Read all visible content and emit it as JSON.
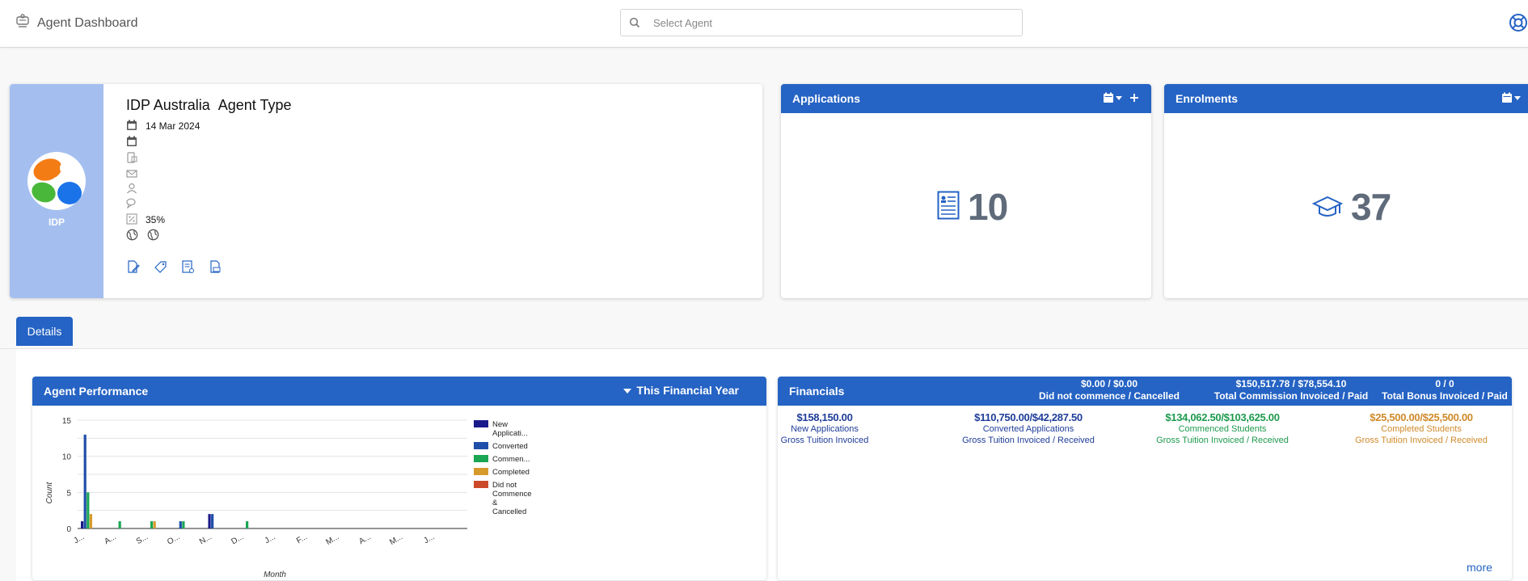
{
  "header": {
    "title": "Agent Dashboard",
    "search_placeholder": "Select Agent"
  },
  "agent": {
    "name": "IDP Australia",
    "type_label": "Agent Type",
    "logo_label": "IDP",
    "date": "14 Mar 2024",
    "commission_rate": "35%"
  },
  "applications": {
    "title": "Applications",
    "count": "10"
  },
  "enrolments": {
    "title": "Enrolments",
    "count": "37"
  },
  "tabs": {
    "details": "Details"
  },
  "performance": {
    "title": "Agent Performance",
    "period": "This Financial Year"
  },
  "financials": {
    "title": "Financials",
    "summary": [
      {
        "value": "$0.00 / $0.00",
        "label": "Did not commence / Cancelled"
      },
      {
        "value": "$150,517.78 / $78,554.10",
        "label": "Total Commission Invoiced / Paid"
      },
      {
        "value": "0 / 0",
        "label": "Total Bonus Invoiced / Paid"
      }
    ],
    "columns": [
      {
        "value": "$158,150.00",
        "label": "New Applications",
        "sub": "Gross Tuition Invoiced",
        "color": "#1f3d99"
      },
      {
        "value": "$110,750.00/$42,287.50",
        "label": "Converted Applications",
        "sub": "Gross Tuition Invoiced / Received",
        "color": "#1f3d99"
      },
      {
        "value": "$134,062.50/$103,625.00",
        "label": "Commenced Students",
        "sub": "Gross Tuition Invoiced / Received",
        "color": "#1e9a4e"
      },
      {
        "value": "$25,500.00/$25,500.00",
        "label": "Completed Students",
        "sub": "Gross Tuition Invoiced / Received",
        "color": "#d08a2a"
      }
    ],
    "more": "more"
  },
  "colors": {
    "brand_blue": "#2563c4",
    "profile_side": "#a4bfef"
  },
  "chart_data": {
    "type": "bar",
    "xlabel": "Month",
    "ylabel": "Count",
    "ylim": [
      0,
      15
    ],
    "yticks": [
      0,
      5,
      10,
      15
    ],
    "grid": true,
    "legend_position": "right",
    "categories": [
      "J...",
      "A...",
      "S...",
      "O...",
      "N...",
      "D...",
      "J...",
      "F...",
      "M...",
      "A...",
      "M...",
      "J..."
    ],
    "series": [
      {
        "name": "New Applicati...",
        "color": "#1a1a8c",
        "values": [
          1,
          0,
          0,
          0,
          2,
          0,
          0,
          0,
          0,
          0,
          0,
          0
        ]
      },
      {
        "name": "Converted",
        "color": "#1f4fa8",
        "values": [
          13,
          0,
          0,
          1,
          2,
          0,
          0,
          0,
          0,
          0,
          0,
          0
        ]
      },
      {
        "name": "Commen...",
        "color": "#1aa653",
        "values": [
          5,
          1,
          1,
          1,
          0,
          1,
          0,
          0,
          0,
          0,
          0,
          0
        ]
      },
      {
        "name": "Completed",
        "color": "#d69a2c",
        "values": [
          2,
          0,
          1,
          0,
          0,
          0,
          0,
          0,
          0,
          0,
          0,
          0
        ]
      },
      {
        "name": "Did not Commence & Cancelled",
        "color": "#cc4a2a",
        "values": [
          0,
          0,
          0,
          0,
          0,
          0,
          0,
          0,
          0,
          0,
          0,
          0
        ]
      }
    ]
  }
}
